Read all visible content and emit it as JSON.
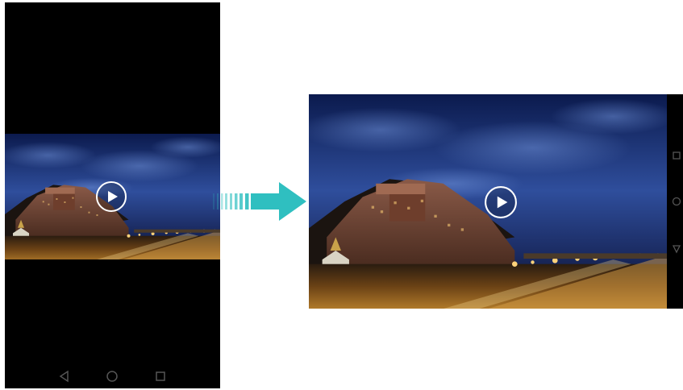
{
  "portrait_screen": {
    "video": {
      "scene": "night-palace-photo",
      "play_icon": "play-icon"
    },
    "nav_bar": {
      "buttons": [
        {
          "name": "back-icon"
        },
        {
          "name": "home-icon"
        },
        {
          "name": "recents-icon"
        }
      ]
    }
  },
  "transition_arrow": {
    "icon": "right-arrow-icon",
    "color": "#2fbfc0"
  },
  "landscape_screen": {
    "video": {
      "scene": "night-palace-photo",
      "play_icon": "play-icon"
    },
    "side_nav": {
      "buttons": [
        {
          "name": "recents-icon"
        },
        {
          "name": "home-icon"
        },
        {
          "name": "back-icon"
        }
      ]
    }
  },
  "colors": {
    "phone_body": "#000000",
    "sky_dark": "#0b1a4d",
    "sky_mid": "#2f4e9c",
    "city_lights": "#f2b43a",
    "arrow_accent": "#2fbfc0"
  }
}
